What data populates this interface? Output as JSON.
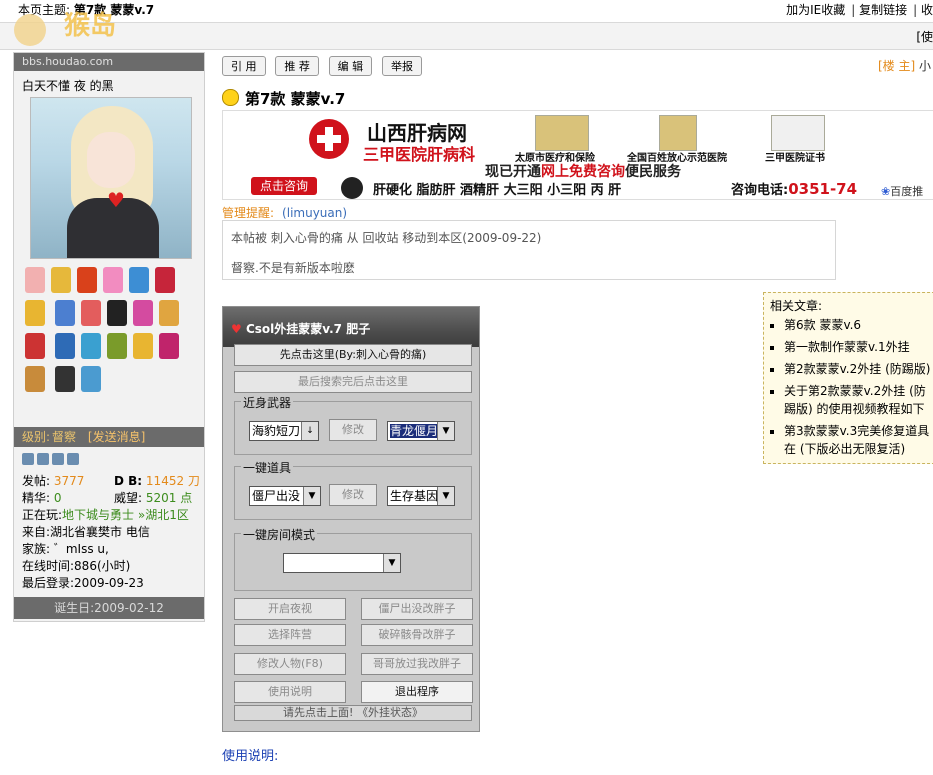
{
  "topbar": {
    "page_topic_label": "本页主题:",
    "page_topic_title": "第7款  蒙蒙v.7",
    "links": [
      "加为IE收藏",
      "复制链接",
      "收"
    ]
  },
  "bar2": {
    "right_text": "[使"
  },
  "logo": {
    "text": "猴岛"
  },
  "sidebar": {
    "site": "bbs.houdao.com",
    "username": "白天不懂 夜 的黑",
    "level_label": "级别:",
    "level_value": "督察",
    "send_message": "[发送消息]",
    "posts_label": "发帖:",
    "posts_value": "3777",
    "db_label": "D B:",
    "db_value": "11452 刀",
    "elite_label": "精华:",
    "elite_value": "0",
    "prestige_label": "威望:",
    "prestige_value": "5201 点",
    "playing_label": "正在玩:",
    "playing_value": "地下城与勇士 »湖北1区",
    "from": "来自:湖北省襄樊市 电信",
    "family": "家族:  ゛mIss u,",
    "online": "在线时间:886(小时)",
    "last_login": "最后登录:2009-09-23",
    "birthday": "诞生日:2009-02-12"
  },
  "post": {
    "buttons": [
      "引 用",
      "推 荐",
      "编 辑",
      "举报"
    ],
    "floor_label": "[楼 主]",
    "floor_extra": "小",
    "title": "第7款  蒙蒙v.7",
    "notice_label": "管理提醒:",
    "notice_user": "(limuyuan)",
    "notice_line1": "本帖被  刺入心骨的痛  从  回收站  移动到本区(2009-09-22)",
    "notice_line2": "督察.不是有新版本啦麽",
    "use_label": "使用说明:"
  },
  "ad": {
    "name": "山西肝病网",
    "subtitle": "三甲医院肝病科",
    "cap1": "太原市医疗和保险",
    "cap2": "全国百姓放心示范医院",
    "cap3": "三甲医院证书",
    "service_prefix": "现已开通",
    "service_red": "网上免费咨询",
    "service_suffix": "便民服务",
    "consult_button": "点击咨询",
    "items": "肝硬化   脂肪肝   酒精肝   大三阳   小三阳   丙 肝",
    "phone_label": "咨询电话:",
    "phone": "0351-74",
    "baidu": "百度推"
  },
  "related": {
    "heading": "相关文章:",
    "items": [
      "第6款  蒙蒙v.6",
      "第一款制作蒙蒙v.1外挂",
      "第2款蒙蒙v.2外挂 (防踢版)",
      "关于第2款蒙蒙v.2外挂 (防踢版) 的使用视频教程如下",
      "第3款蒙蒙v.3完美修复道具在 (下版必出无限复活)"
    ]
  },
  "tool": {
    "title": "Csol外挂蒙蒙v.7 肥子",
    "btn_first": "先点击这里(By:刺入心骨的痛)",
    "btn_last": "最后搜索完后点击这里",
    "grp_melee": "近身武器",
    "melee_select": "海豹短刀",
    "modify": "修改",
    "melee_target": "青龙偃月刀",
    "grp_item": "一键道具",
    "item_select": "僵尸出没",
    "item_target": "生存基因",
    "grp_room": "一键房间模式",
    "room_select": "",
    "night": "开启夜视",
    "zombie_fat": "僵尸出没改胖子",
    "camp": "选择阵营",
    "skeleton_fat": "破碎骸骨改胖子",
    "modify_char": "修改人物(F8)",
    "brother_fat": "哥哥放过我改胖子",
    "manual": "使用说明",
    "exit": "退出程序",
    "status": "请先点击上面!  《外挂状态》"
  }
}
